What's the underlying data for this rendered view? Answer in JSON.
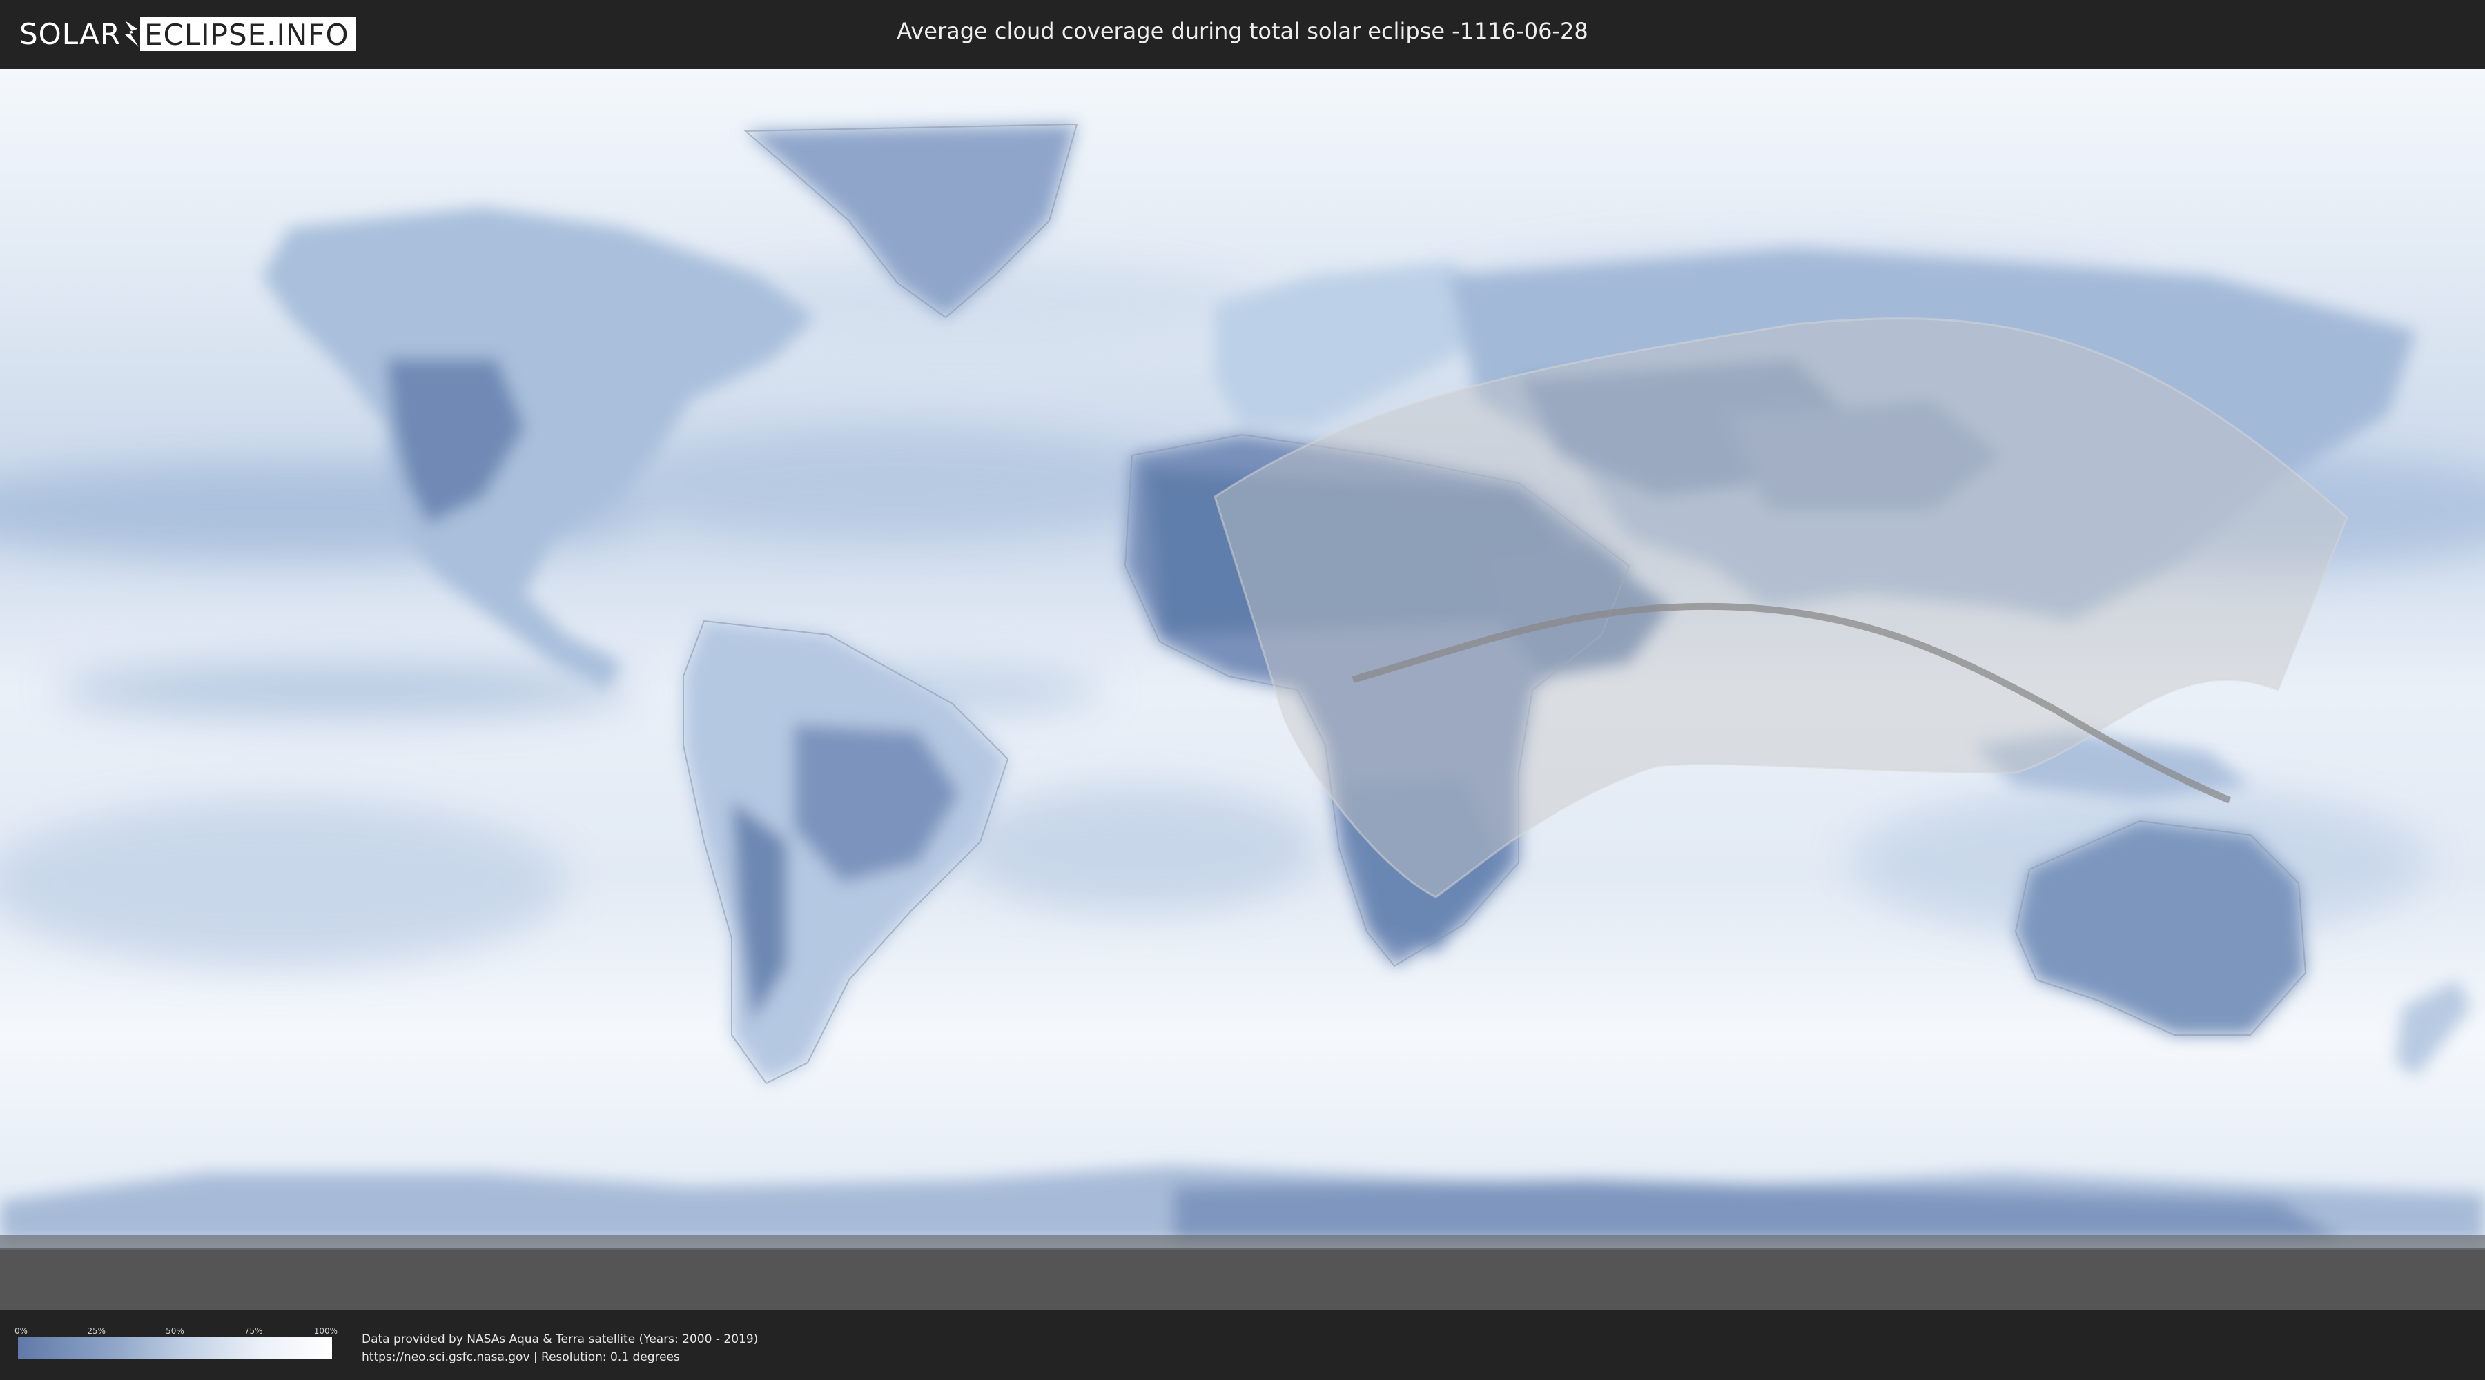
{
  "header": {
    "logo_left": "SOLAR",
    "logo_right": "ECLIPSE.INFO",
    "title": "Average cloud coverage during total solar eclipse -1116-06-28"
  },
  "legend": {
    "ticks": [
      "0%",
      "25%",
      "50%",
      "75%",
      "100%"
    ],
    "colors": {
      "low": "#5f7aa8",
      "high": "#ffffff"
    }
  },
  "credits": {
    "line1": "Data provided by NASAs Aqua & Terra satellite (Years: 2000 - 2019)",
    "line2": "https://neo.sci.gsfc.nasa.gov | Resolution: 0.1 degrees"
  },
  "map": {
    "layers": [
      "cloud-coverage",
      "coastlines",
      "country-borders",
      "penumbra-region",
      "central-line"
    ],
    "colors": {
      "ocean_cloud": "#e6eef7",
      "low_cloud": "#5a78a8",
      "penumbra": "#c8c8c8",
      "central_line": "#8a8a8a",
      "below_map": "#555555"
    }
  }
}
